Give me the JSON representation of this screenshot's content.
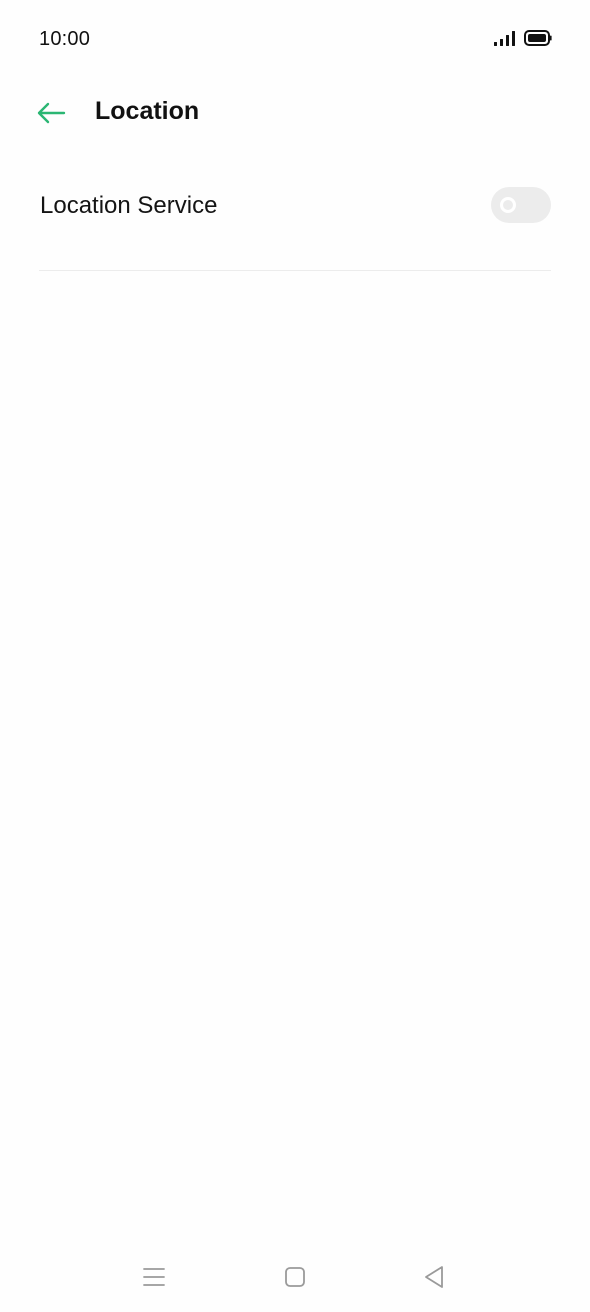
{
  "status_bar": {
    "time": "10:00",
    "icons": [
      "signal-icon",
      "battery-icon"
    ]
  },
  "header": {
    "back_icon": "arrow-left-icon",
    "title": "Location"
  },
  "settings": {
    "location_service": {
      "label": "Location Service",
      "enabled": false
    }
  },
  "nav_bar": {
    "icons": [
      "menu-icon",
      "home-icon",
      "back-icon"
    ]
  },
  "colors": {
    "accent": "#2bb673",
    "toggle_off": "#ececec",
    "divider": "#ececec",
    "text": "#111111",
    "nav_icon": "#9a9a9a"
  }
}
